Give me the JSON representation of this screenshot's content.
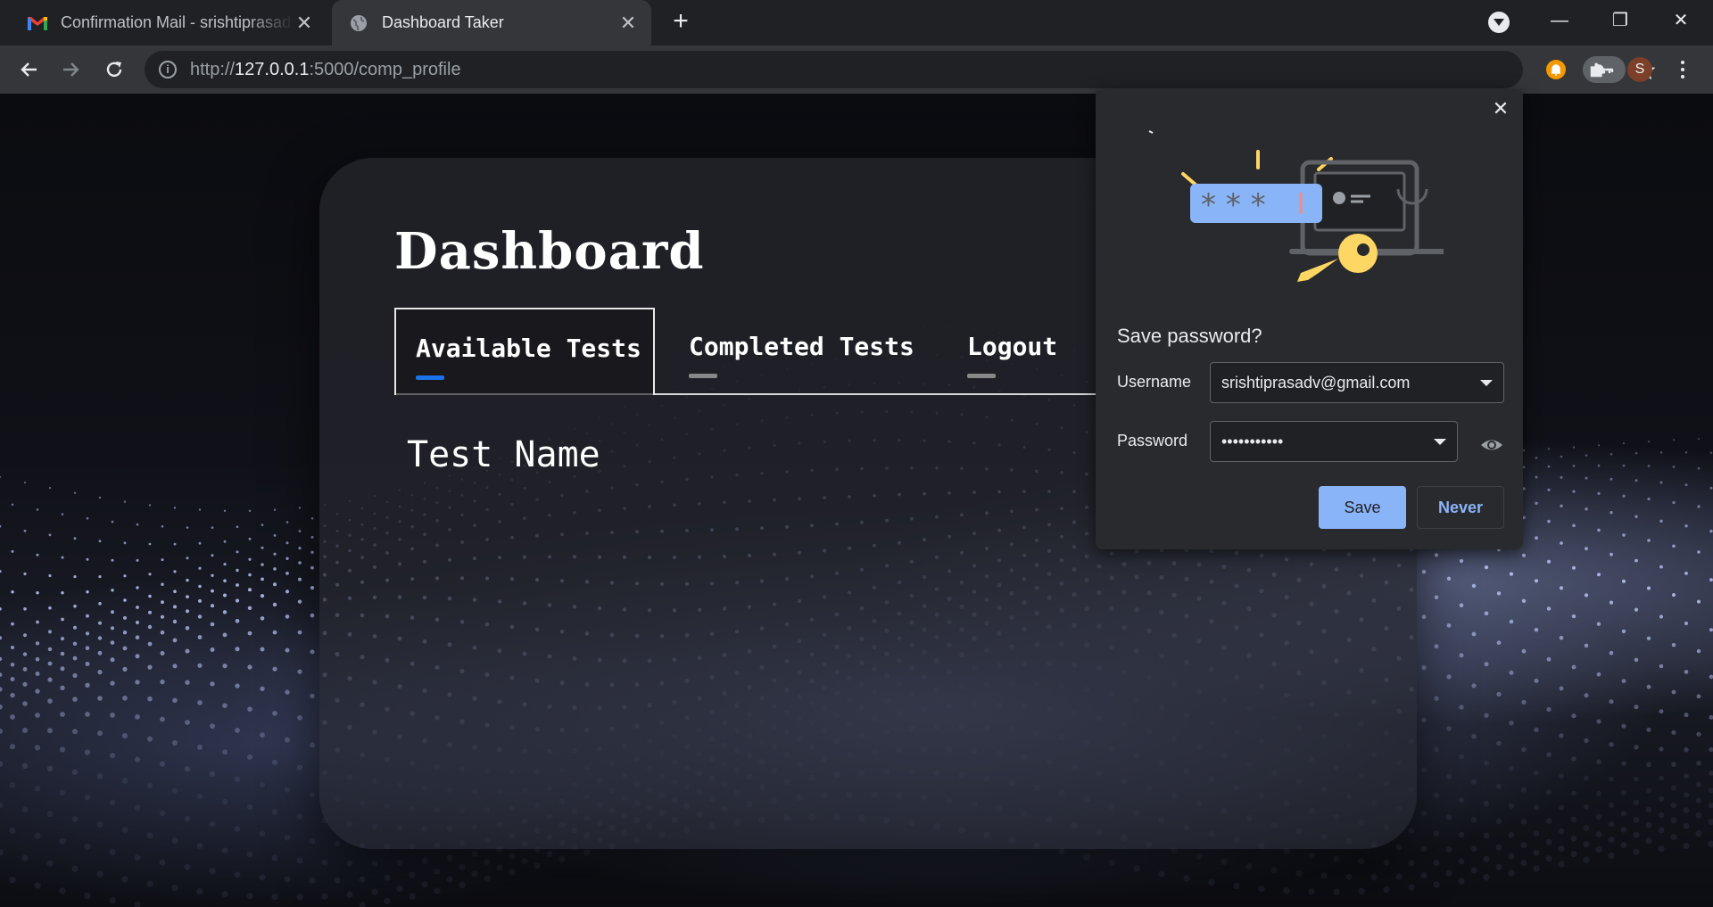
{
  "browser": {
    "tabs": [
      {
        "title": "Confirmation Mail - srishtiprasadv@gmail.com",
        "active": false
      },
      {
        "title": "Dashboard Taker",
        "active": true
      }
    ],
    "url_scheme": "http://",
    "url_host": "127.0.0.1",
    "url_rest": ":5000/comp_profile",
    "avatar_letter": "S"
  },
  "page": {
    "title": "Dashboard",
    "nav": [
      {
        "label": "Available Tests",
        "active": true
      },
      {
        "label": "Completed Tests",
        "active": false
      },
      {
        "label": "Logout",
        "active": false
      }
    ],
    "column_header": "Test Name"
  },
  "save_password": {
    "heading": "Save password?",
    "username_label": "Username",
    "username_value": "srishtiprasadv@gmail.com",
    "password_label": "Password",
    "password_value": "•••••••••••",
    "save_label": "Save",
    "never_label": "Never"
  },
  "colors": {
    "accent_blue": "#1a73e8",
    "save_button": "#8ab4f8",
    "chrome_dark": "#202124"
  }
}
